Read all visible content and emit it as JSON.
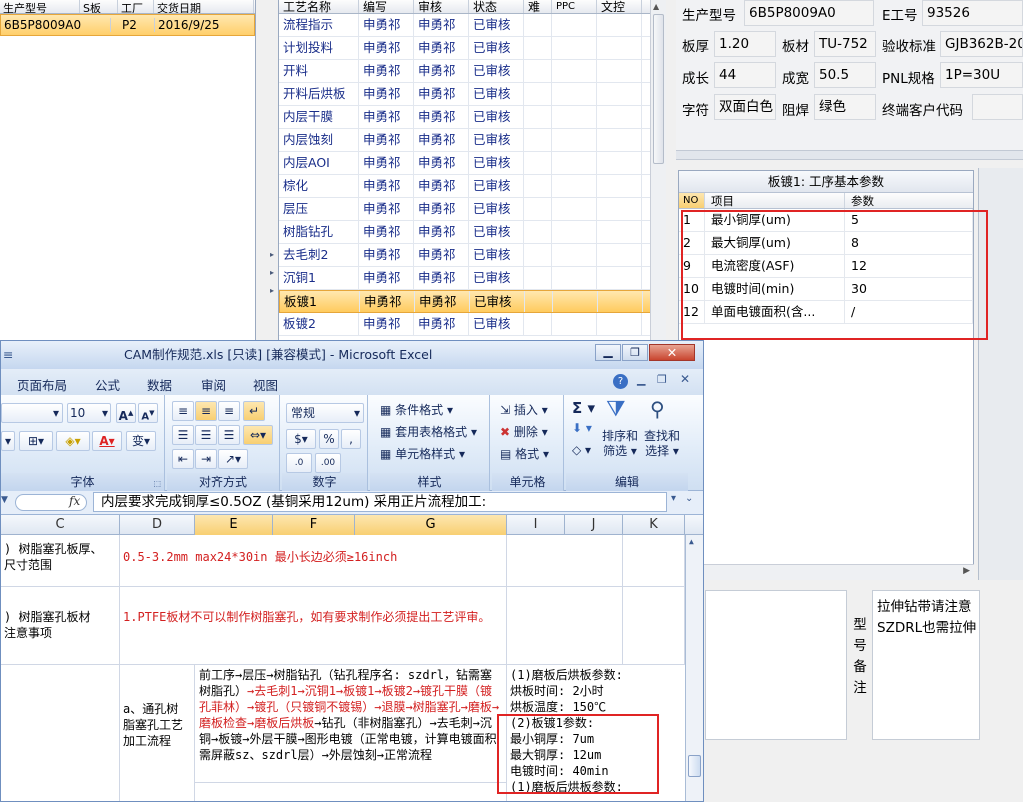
{
  "orders": {
    "columns": [
      "生产型号",
      "S板",
      "工厂",
      "交货日期"
    ],
    "row": {
      "model": "6B5P8009A0",
      "s": "",
      "factory": "P2",
      "date": "2016/9/25"
    }
  },
  "process": {
    "columns": [
      "工艺名称",
      "编写",
      "审核",
      "状态",
      "难",
      "PPC",
      "文控"
    ],
    "rows": [
      {
        "name": "流程指示",
        "author": "申勇祁",
        "auditor": "申勇祁",
        "status": "已审核"
      },
      {
        "name": "计划投料",
        "author": "申勇祁",
        "auditor": "申勇祁",
        "status": "已审核"
      },
      {
        "name": "开料",
        "author": "申勇祁",
        "auditor": "申勇祁",
        "status": "已审核"
      },
      {
        "name": "开料后烘板",
        "author": "申勇祁",
        "auditor": "申勇祁",
        "status": "已审核"
      },
      {
        "name": "内层干膜",
        "author": "申勇祁",
        "auditor": "申勇祁",
        "status": "已审核"
      },
      {
        "name": "内层蚀刻",
        "author": "申勇祁",
        "auditor": "申勇祁",
        "status": "已审核"
      },
      {
        "name": "内层AOI",
        "author": "申勇祁",
        "auditor": "申勇祁",
        "status": "已审核"
      },
      {
        "name": "棕化",
        "author": "申勇祁",
        "auditor": "申勇祁",
        "status": "已审核"
      },
      {
        "name": "层压",
        "author": "申勇祁",
        "auditor": "申勇祁",
        "status": "已审核"
      },
      {
        "name": "树脂钻孔",
        "author": "申勇祁",
        "auditor": "申勇祁",
        "status": "已审核"
      },
      {
        "name": "去毛刺2",
        "author": "申勇祁",
        "auditor": "申勇祁",
        "status": "已审核"
      },
      {
        "name": "沉铜1",
        "author": "申勇祁",
        "auditor": "申勇祁",
        "status": "已审核"
      },
      {
        "name": "板镀1",
        "author": "申勇祁",
        "auditor": "申勇祁",
        "status": "已审核"
      },
      {
        "name": "板镀2",
        "author": "申勇祁",
        "auditor": "申勇祁",
        "status": "已审核"
      }
    ],
    "selected_index": 12
  },
  "info": {
    "model_label": "生产型号",
    "model_value": "6B5P8009A0",
    "eno_label": "E工号",
    "eno_value": "93526",
    "thickness_label": "板厚",
    "thickness_value": "1.20",
    "material_label": "板材",
    "material_value": "TU-752",
    "std_label": "验收标准",
    "std_value": "GJB362B-20",
    "len_label": "成长",
    "len_value": "44",
    "width_label": "成宽",
    "width_value": "50.5",
    "pnl_label": "PNL规格",
    "pnl_value": "1P=30U",
    "char_label": "字符",
    "char_value": "双面白色",
    "mask_label": "阻焊",
    "mask_value": "绿色",
    "cust_label": "终端客户代码",
    "cust_value": ""
  },
  "param": {
    "title": "板镀1: 工序基本参数",
    "columns": [
      "NO",
      "项目",
      "参数"
    ],
    "rows": [
      {
        "no": "1",
        "item": "最小铜厚(um)",
        "value": "5"
      },
      {
        "no": "2",
        "item": "最大铜厚(um)",
        "value": "8"
      },
      {
        "no": "9",
        "item": "电流密度(ASF)",
        "value": "12"
      },
      {
        "no": "10",
        "item": "电镀时间(min)",
        "value": "30"
      },
      {
        "no": "12",
        "item": "单面电镀面积(含...",
        "value": "/"
      }
    ]
  },
  "remark": {
    "label_chars": [
      "型",
      "号",
      "备",
      "注"
    ],
    "lines": [
      "拉伸钻带请注意",
      "SZDRL也需拉伸"
    ]
  },
  "excel": {
    "title": "CAM制作规范.xls [只读] [兼容模式] - Microsoft Excel",
    "menu": [
      "页面布局",
      "公式",
      "数据",
      "审阅",
      "视图"
    ],
    "font_size": "10",
    "number_format": "常规",
    "groups": {
      "font": "字体",
      "align": "对齐方式",
      "number": "数字",
      "style": "样式",
      "cells": "单元格",
      "edit": "编辑"
    },
    "style_items": [
      "条件格式",
      "套用表格格式",
      "单元格样式"
    ],
    "cell_items": [
      "插入",
      "删除",
      "格式"
    ],
    "edit_items": {
      "sort1": "排序和",
      "sort2": "筛选",
      "find1": "查找和",
      "find2": "选择"
    },
    "fx": "fx",
    "formula": "内层要求完成铜厚≤0.5OZ (基铜采用12um) 采用正片流程加工:",
    "columns": [
      "C",
      "D",
      "E",
      "F",
      "G",
      "I",
      "J",
      "K"
    ],
    "rows": {
      "r1c": ") 树脂塞孔板厚、\n尺寸范围",
      "r1d": "0.5-3.2mm    max24*30in 最小长边必须≥16inch",
      "r2c": ") 树脂塞孔板材\n注意事项",
      "r2d": "1.PTFE板材不可以制作树脂塞孔，如有要求制作必须提出工艺评审。",
      "r3c": "",
      "r3d": "a、通孔树\n脂塞孔工艺\n加工流程",
      "r3e_black1": "前工序→层压→树脂钻孔（钻孔程序名: szdrl，钻需塞树脂孔）",
      "r3e_red1": "→去毛刺1→沉铜1→板镀1→板镀2→镀孔干膜（镀孔菲林）→镀孔（只镀铜不镀锡）→退膜→树脂塞孔→磨板→磨板检查→磨板后烘板",
      "r3e_black2": "→钻孔（非树脂塞孔）→去毛刺→沉铜→板镀→外层干膜→图形电镀（正常电镀，计算电镀面积需屏蔽sz、szdrl层）→外层蚀刻→正常流程",
      "r3i": [
        "(1)磨板后烘板参数:",
        "烘板时间: 2小时",
        "烘板温度: 150℃",
        "(2)板镀1参数:",
        "最小铜厚: 7um",
        "最大铜厚: 12um",
        "电镀时间: 40min",
        "(1)磨板后烘板参数:"
      ]
    }
  },
  "colors": {
    "highlight": "#ffcf6b",
    "red_box": "#e02424",
    "blue_text": "#1a2e8a",
    "red_text": "#d32020"
  }
}
